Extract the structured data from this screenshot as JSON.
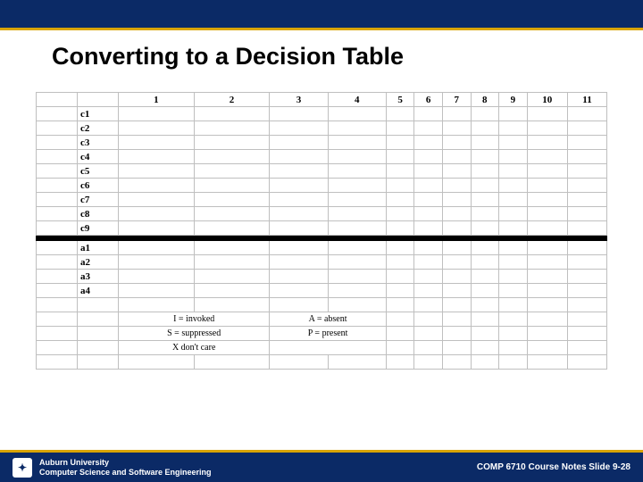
{
  "slide": {
    "title": "Converting to a Decision Table"
  },
  "table": {
    "columns": [
      "1",
      "2",
      "3",
      "4",
      "5",
      "6",
      "7",
      "8",
      "9",
      "10",
      "11"
    ],
    "condition_rows": [
      "c1",
      "c2",
      "c3",
      "c4",
      "c5",
      "c6",
      "c7",
      "c8",
      "c9"
    ],
    "action_rows": [
      "a1",
      "a2",
      "a3",
      "a4"
    ]
  },
  "legend": {
    "l1a": "I  = invoked",
    "l1b": "A = absent",
    "l2a": "S = suppressed",
    "l2b": "P = present",
    "l3a": "X    don't care"
  },
  "footer": {
    "uni": "Auburn University",
    "dept": "Computer Science and Software Engineering",
    "right": "COMP 6710 Course Notes Slide 9-28"
  }
}
